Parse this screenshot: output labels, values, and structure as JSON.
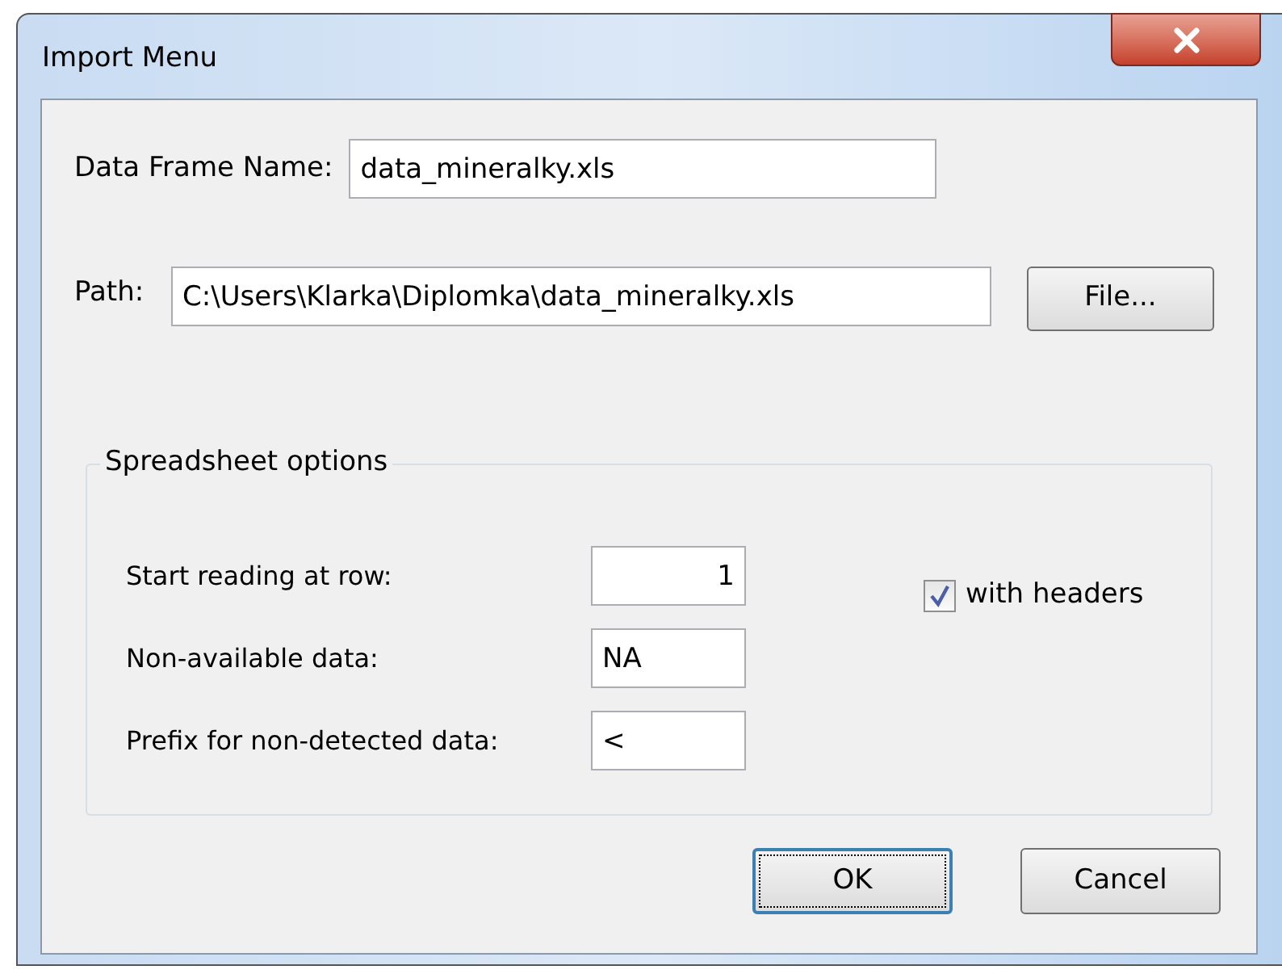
{
  "window": {
    "title": "Import Menu"
  },
  "data_frame_name": {
    "label": "Data Frame Name:",
    "value": "data_mineralky.xls"
  },
  "path": {
    "label": "Path:",
    "value": "C:\\Users\\Klarka\\Diplomka\\data_mineralky.xls",
    "button": "File..."
  },
  "spreadsheet_options": {
    "title": "Spreadsheet options",
    "rows": [
      {
        "label": "Start reading at row:",
        "value": "1",
        "kind": "number"
      },
      {
        "label": "Non-available data:",
        "value": "NA",
        "kind": "text"
      },
      {
        "label": "Prefix for non-detected data:",
        "value": "<",
        "kind": "text"
      }
    ],
    "with_headers": {
      "label": "with headers",
      "checked": true
    }
  },
  "buttons": [
    {
      "label": "OK",
      "focused": true
    },
    {
      "label": "Cancel",
      "focused": false
    }
  ]
}
